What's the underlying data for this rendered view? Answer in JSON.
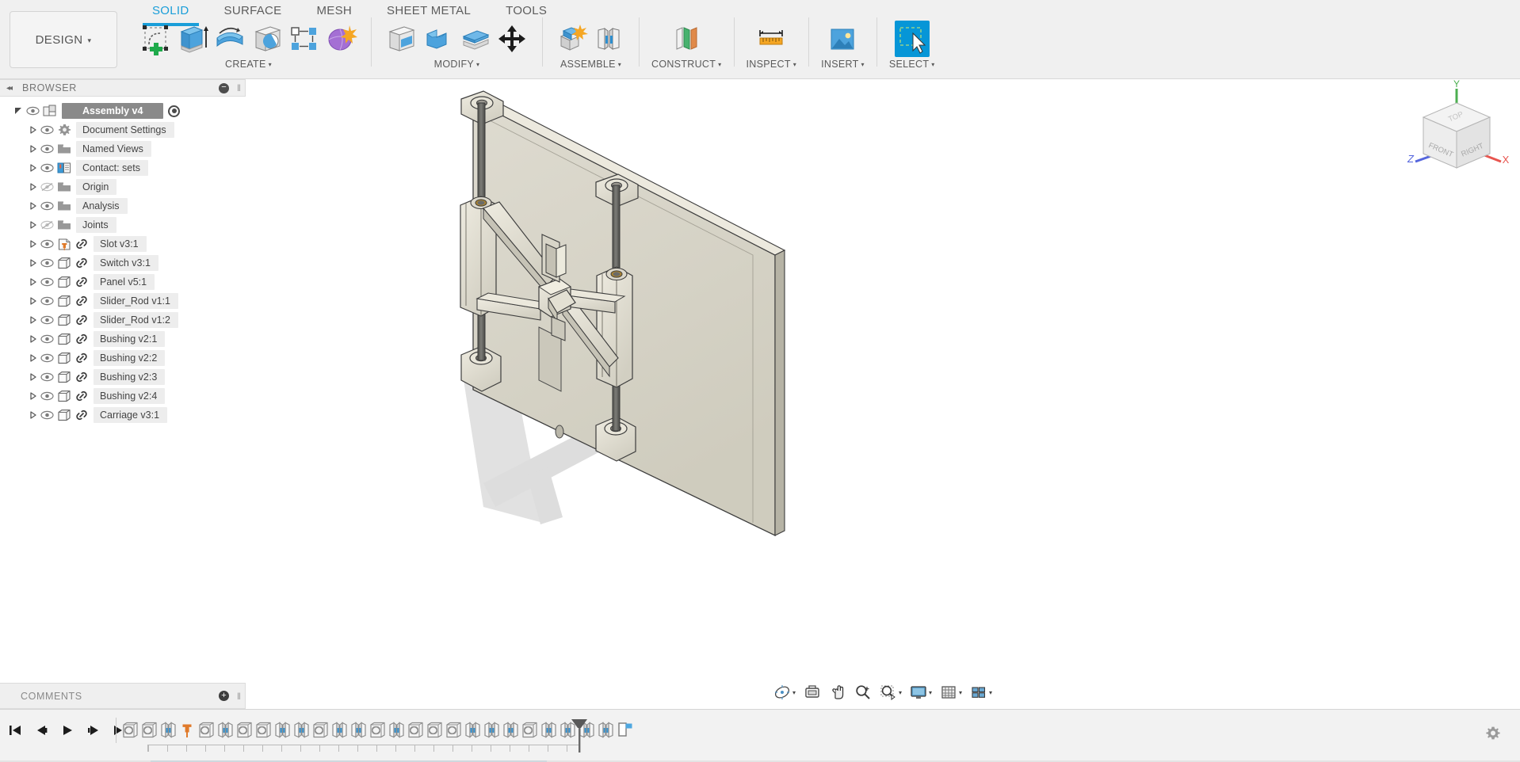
{
  "app": {
    "workspace_label": "DESIGN",
    "workspace_caret": "▾"
  },
  "toolbar": {
    "tabs": [
      {
        "label": "SOLID",
        "active": true
      },
      {
        "label": "SURFACE",
        "active": false
      },
      {
        "label": "MESH",
        "active": false
      },
      {
        "label": "SHEET METAL",
        "active": false
      },
      {
        "label": "TOOLS",
        "active": false
      }
    ],
    "groups": [
      {
        "label": "CREATE",
        "caret": "▾"
      },
      {
        "label": "MODIFY",
        "caret": "▾"
      },
      {
        "label": "ASSEMBLE",
        "caret": "▾"
      },
      {
        "label": "CONSTRUCT",
        "caret": "▾"
      },
      {
        "label": "INSPECT",
        "caret": "▾"
      },
      {
        "label": "INSERT",
        "caret": "▾"
      },
      {
        "label": "SELECT",
        "caret": "▾"
      }
    ],
    "icon_names": [
      "create-sketch-icon",
      "extrude-icon",
      "revolve-icon",
      "hole-icon",
      "pattern-icon",
      "create-form-icon",
      "press-pull-icon",
      "fillet-icon",
      "shell-icon",
      "combine-icon",
      "offset-face-icon",
      "move-copy-icon",
      "new-component-icon",
      "joint-icon",
      "offset-plane-icon",
      "measure-icon",
      "insert-mcmaster-icon",
      "select-icon"
    ]
  },
  "browser": {
    "title": "BROWSER",
    "collapse_glyph": "◂◂",
    "minus_glyph": "−",
    "grip_glyph": "‖",
    "root": {
      "label": "Assembly v4",
      "icon": "assembly-icon",
      "visible": true,
      "has_activate_radio": true
    },
    "items": [
      {
        "label": "Document Settings",
        "icon": "gear-icon",
        "visible": true,
        "link": false
      },
      {
        "label": "Named Views",
        "icon": "folder-icon",
        "visible": true,
        "link": false
      },
      {
        "label": "Contact: sets",
        "icon": "contact-sets-icon",
        "visible": true,
        "link": false
      },
      {
        "label": "Origin",
        "icon": "folder-icon",
        "visible": false,
        "link": false
      },
      {
        "label": "Analysis",
        "icon": "folder-icon",
        "visible": true,
        "link": false
      },
      {
        "label": "Joints",
        "icon": "folder-icon",
        "visible": false,
        "link": false
      },
      {
        "label": "Slot v3:1",
        "icon": "component-pin-icon",
        "visible": true,
        "link": true
      },
      {
        "label": "Switch v3:1",
        "icon": "component-icon",
        "visible": true,
        "link": true
      },
      {
        "label": "Panel v5:1",
        "icon": "component-icon",
        "visible": true,
        "link": true
      },
      {
        "label": "Slider_Rod v1:1",
        "icon": "component-icon",
        "visible": true,
        "link": true
      },
      {
        "label": "Slider_Rod v1:2",
        "icon": "component-icon",
        "visible": true,
        "link": true
      },
      {
        "label": "Bushing v2:1",
        "icon": "component-icon",
        "visible": true,
        "link": true
      },
      {
        "label": "Bushing v2:2",
        "icon": "component-icon",
        "visible": true,
        "link": true
      },
      {
        "label": "Bushing v2:3",
        "icon": "component-icon",
        "visible": true,
        "link": true
      },
      {
        "label": "Bushing v2:4",
        "icon": "component-icon",
        "visible": true,
        "link": true
      },
      {
        "label": "Carriage v3:1",
        "icon": "component-icon",
        "visible": true,
        "link": true
      }
    ]
  },
  "comments": {
    "title": "COMMENTS",
    "plus_glyph": "+",
    "grip_glyph": "‖"
  },
  "viewcube": {
    "top_face": "TOP",
    "front_face": "FRONT",
    "right_face": "RIGHT",
    "axis_x": "X",
    "axis_y": "Y",
    "axis_z": "Z",
    "color_x": "#e8554f",
    "color_y": "#4caf50",
    "color_z": "#5566dd"
  },
  "navbar": {
    "buttons": [
      {
        "name": "orbit-icon",
        "caret": "▾"
      },
      {
        "name": "look-at-icon",
        "caret": ""
      },
      {
        "name": "pan-icon",
        "caret": ""
      },
      {
        "name": "zoom-icon",
        "caret": ""
      },
      {
        "name": "zoom-window-icon",
        "caret": "▾"
      },
      {
        "name": "display-settings-icon",
        "caret": "▾"
      },
      {
        "name": "grid-snaps-icon",
        "caret": "▾"
      },
      {
        "name": "viewports-icon",
        "caret": "▾"
      }
    ]
  },
  "timeline": {
    "playback": [
      {
        "name": "go-to-beginning-button",
        "glyph": "skip-back"
      },
      {
        "name": "step-back-button",
        "glyph": "step-back"
      },
      {
        "name": "play-button",
        "glyph": "play"
      },
      {
        "name": "step-forward-button",
        "glyph": "step-forward"
      },
      {
        "name": "go-to-end-button",
        "glyph": "skip-end"
      }
    ],
    "features": [
      {
        "type": "contact",
        "name": "timeline-feature-contact"
      },
      {
        "type": "contact",
        "name": "timeline-feature-contact"
      },
      {
        "type": "joint",
        "name": "timeline-feature-joint"
      },
      {
        "type": "pin",
        "name": "timeline-feature-pin"
      },
      {
        "type": "contact",
        "name": "timeline-feature-contact"
      },
      {
        "type": "joint",
        "name": "timeline-feature-joint"
      },
      {
        "type": "contact",
        "name": "timeline-feature-contact"
      },
      {
        "type": "contact",
        "name": "timeline-feature-contact"
      },
      {
        "type": "joint",
        "name": "timeline-feature-joint"
      },
      {
        "type": "joint",
        "name": "timeline-feature-joint"
      },
      {
        "type": "contact",
        "name": "timeline-feature-contact"
      },
      {
        "type": "joint",
        "name": "timeline-feature-joint"
      },
      {
        "type": "joint",
        "name": "timeline-feature-joint"
      },
      {
        "type": "contact",
        "name": "timeline-feature-contact"
      },
      {
        "type": "joint",
        "name": "timeline-feature-joint"
      },
      {
        "type": "contact",
        "name": "timeline-feature-contact"
      },
      {
        "type": "contact",
        "name": "timeline-feature-contact"
      },
      {
        "type": "contact",
        "name": "timeline-feature-contact"
      },
      {
        "type": "joint",
        "name": "timeline-feature-joint"
      },
      {
        "type": "joint",
        "name": "timeline-feature-joint"
      },
      {
        "type": "joint",
        "name": "timeline-feature-joint"
      },
      {
        "type": "contact",
        "name": "timeline-feature-contact"
      },
      {
        "type": "joint",
        "name": "timeline-feature-joint"
      },
      {
        "type": "joint",
        "name": "timeline-feature-joint"
      },
      {
        "type": "joint",
        "name": "timeline-feature-joint"
      },
      {
        "type": "joint",
        "name": "timeline-feature-joint"
      },
      {
        "type": "selected",
        "name": "timeline-feature-selected"
      }
    ],
    "settings_icon": "gear-icon"
  },
  "model": {
    "description": "Slider-crank linkage assembly mounted on a flat panel",
    "colors": {
      "panel_face": "#d6d3c6",
      "panel_edge_light": "#e8e5d9",
      "panel_side": "#b9b6a8",
      "rod": "#6a6a66",
      "bushing_bore": "#b08a34",
      "shadow": "#c9c9c9",
      "outline": "#3c3c3c"
    }
  }
}
